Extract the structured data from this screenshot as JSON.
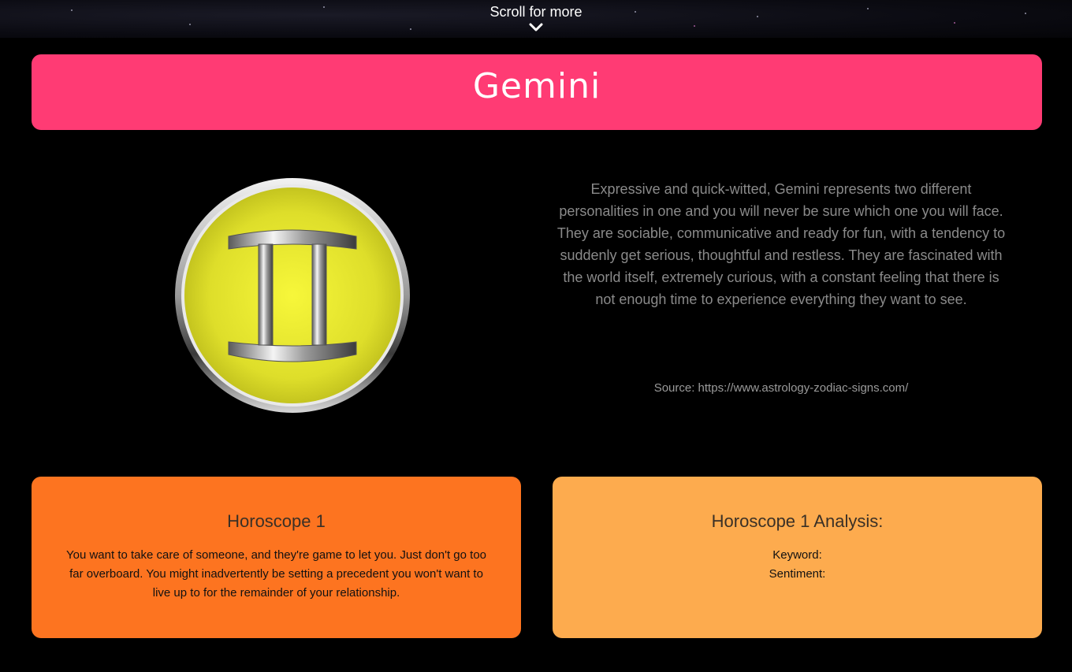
{
  "header": {
    "scroll_label": "Scroll for more",
    "scroll_icon": "chevron-down-icon"
  },
  "sign": {
    "name": "Gemini",
    "symbol_icon": "gemini-symbol-icon",
    "description": "Expressive and quick-witted, Gemini represents two different personalities in one and you will never be sure which one you will face. They are sociable, communicative and ready for fun, with a tendency to suddenly get serious, thoughtful and restless. They are fascinated with the world itself, extremely curious, with a constant feeling that there is not enough time to experience everything they want to see.",
    "source": "Source: https://www.astrology-zodiac-signs.com/"
  },
  "horoscope": {
    "title": "Horoscope 1",
    "text": "You want to take care of someone, and they're game to let you. Just don't go too far overboard. You might inadvertently be setting a precedent you won't want to live up to for the remainder of your relationship."
  },
  "analysis": {
    "title": "Horoscope 1 Analysis:",
    "keyword_label": "Keyword:",
    "sentiment_label": "Sentiment:"
  },
  "colors": {
    "title_banner": "#ff3b74",
    "horoscope_card": "#fd7420",
    "analysis_card": "#fdab4e",
    "symbol_fill": "#e6e830",
    "background": "#000000"
  }
}
